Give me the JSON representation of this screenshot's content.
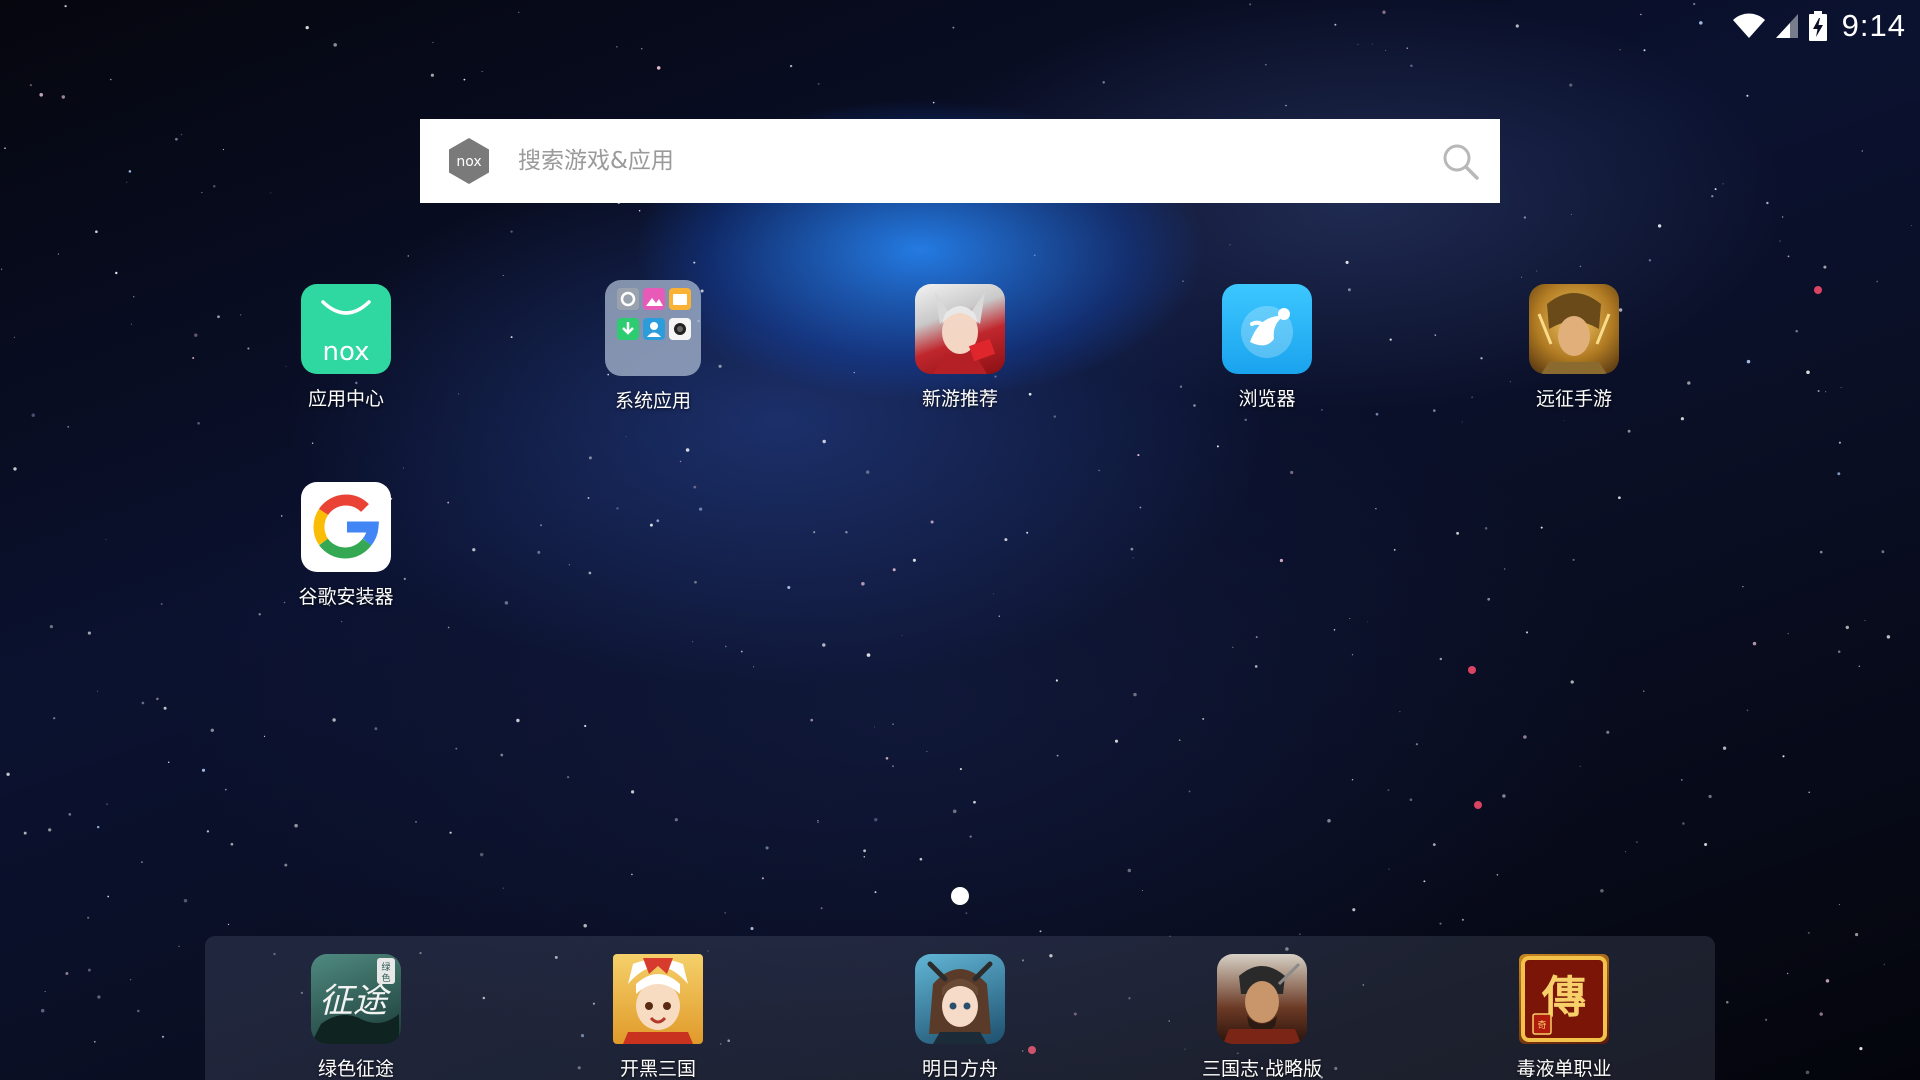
{
  "status_bar": {
    "time": "9:14",
    "icons": [
      "wifi-icon",
      "cell-signal-icon",
      "battery-charging-icon"
    ]
  },
  "search": {
    "placeholder": "搜索游戏&应用",
    "logo_icon": "nox-logo-icon",
    "search_icon": "search-icon"
  },
  "apps": [
    {
      "label": "应用中心",
      "icon": "nox-app-center-icon",
      "color": "#2ed8a0"
    },
    {
      "label": "系统应用",
      "icon": "system-apps-folder-icon",
      "color": "#8fa3bf"
    },
    {
      "label": "新游推荐",
      "icon": "new-game-recommend-icon",
      "color": "#d8333a"
    },
    {
      "label": "浏览器",
      "icon": "browser-icon",
      "color": "#29b6f6"
    },
    {
      "label": "远征手游",
      "icon": "yuanzheng-game-icon",
      "color": "#c9962e"
    },
    {
      "label": "谷歌安装器",
      "icon": "google-installer-icon",
      "color": "#ffffff"
    }
  ],
  "dock": [
    {
      "label": "绿色征途",
      "icon": "lvse-zhengtu-game-icon",
      "color": "#2c5a55"
    },
    {
      "label": "开黑三国",
      "icon": "kaihei-sanguo-game-icon",
      "color": "#e8b840"
    },
    {
      "label": "明日方舟",
      "icon": "arknights-game-icon",
      "color": "#3a7fa0"
    },
    {
      "label": "三国志·战略版",
      "icon": "sanguozhi-zhanlue-game-icon",
      "color": "#7a3b25"
    },
    {
      "label": "毒液单职业",
      "icon": "duye-danzhiye-game-icon",
      "color": "#8a1a10"
    }
  ],
  "page_indicator": {
    "current": 1,
    "total": 1
  }
}
